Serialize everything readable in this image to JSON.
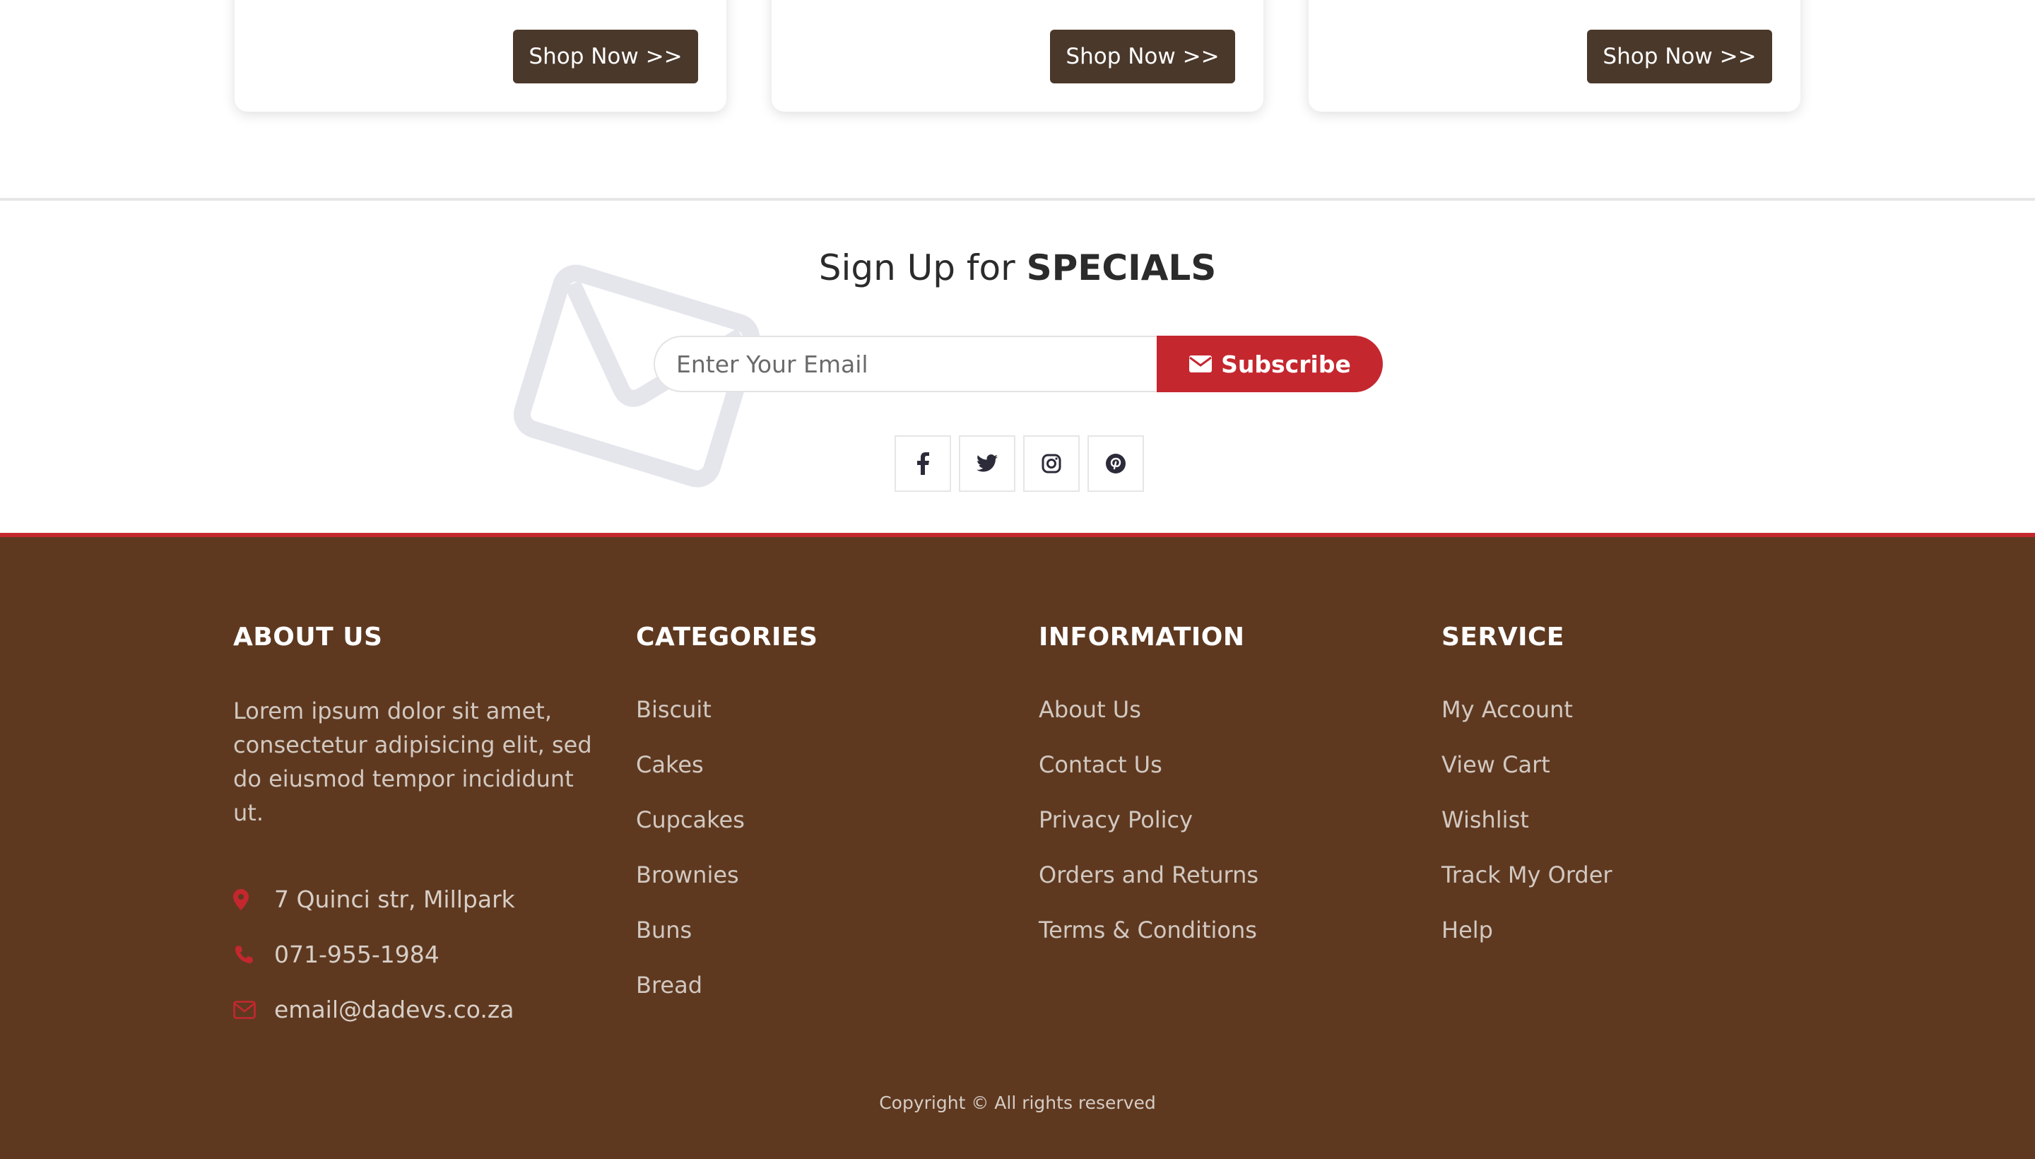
{
  "cards": [
    {
      "button": "Shop Now >>"
    },
    {
      "button": "Shop Now >>"
    },
    {
      "button": "Shop Now >>"
    }
  ],
  "newsletter": {
    "title_prefix": "Sign Up for",
    "title_emphasis": "SPECIALS",
    "email_placeholder": "Enter Your Email",
    "subscribe_label": "Subscribe"
  },
  "social": [
    "facebook-icon",
    "twitter-icon",
    "instagram-icon",
    "pinterest-icon"
  ],
  "footer": {
    "about": {
      "heading": "ABOUT US",
      "text": "Lorem ipsum dolor sit amet, consectetur adipisicing elit, sed do eiusmod tempor incididunt ut.",
      "address": "7 Quinci str, Millpark",
      "phone": "071-955-1984",
      "email": "email@dadevs.co.za"
    },
    "categories": {
      "heading": "CATEGORIES",
      "items": [
        "Biscuit",
        "Cakes",
        "Cupcakes",
        "Brownies",
        "Buns",
        "Bread"
      ]
    },
    "information": {
      "heading": "INFORMATION",
      "items": [
        "About Us",
        "Contact Us",
        "Privacy Policy",
        "Orders and Returns",
        "Terms & Conditions"
      ]
    },
    "service": {
      "heading": "SERVICE",
      "items": [
        "My Account",
        "View Cart",
        "Wishlist",
        "Track My Order",
        "Help"
      ]
    },
    "copyright": "Copyright © All rights reserved"
  },
  "colors": {
    "accent": "#c5272f",
    "footer_bg": "#5e3920",
    "button_dark": "#4a382b"
  }
}
